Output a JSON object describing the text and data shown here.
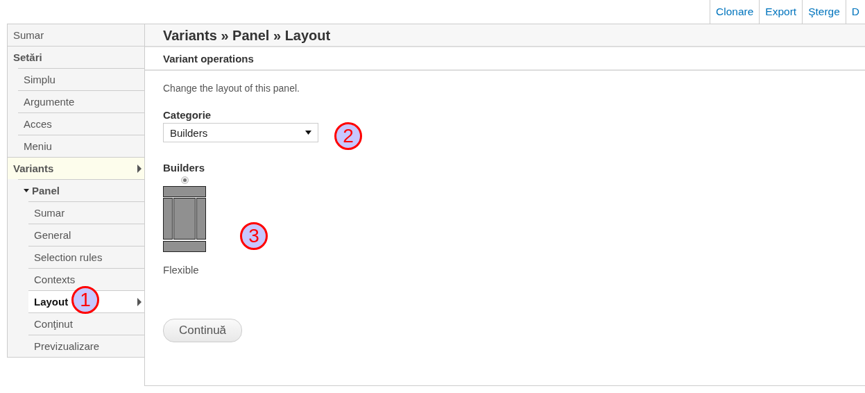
{
  "actions": [
    "Clonare",
    "Export",
    "Şterge",
    "D"
  ],
  "sidebar": {
    "items": [
      {
        "label": "Sumar",
        "kind": "link",
        "selected": false,
        "in_trail": false
      },
      {
        "label": "Setări",
        "kind": "heading",
        "selected": false,
        "in_trail": false,
        "children": [
          {
            "label": "Simplu",
            "kind": "link",
            "selected": false,
            "in_trail": false
          },
          {
            "label": "Argumente",
            "kind": "link",
            "selected": false,
            "in_trail": false
          },
          {
            "label": "Acces",
            "kind": "link",
            "selected": false,
            "in_trail": false
          },
          {
            "label": "Meniu",
            "kind": "link",
            "selected": false,
            "in_trail": false
          }
        ]
      },
      {
        "label": "Variants",
        "kind": "heading",
        "selected": false,
        "in_trail": true,
        "children": [
          {
            "label": "Panel",
            "kind": "heading",
            "selected": false,
            "in_trail": false,
            "expanded": true,
            "children": [
              {
                "label": "Sumar",
                "kind": "link",
                "selected": false,
                "in_trail": false
              },
              {
                "label": "General",
                "kind": "link",
                "selected": false,
                "in_trail": false
              },
              {
                "label": "Selection rules",
                "kind": "link",
                "selected": false,
                "in_trail": false
              },
              {
                "label": "Contexts",
                "kind": "link",
                "selected": false,
                "in_trail": false
              },
              {
                "label": "Layout",
                "kind": "link",
                "selected": true,
                "in_trail": false
              },
              {
                "label": "Conţinut",
                "kind": "link",
                "selected": false,
                "in_trail": false
              },
              {
                "label": "Previzualizare",
                "kind": "link",
                "selected": false,
                "in_trail": false
              }
            ]
          }
        ]
      }
    ]
  },
  "title": "Variants » Panel » Layout",
  "section": "Variant operations",
  "description": "Change the layout of this panel.",
  "category": {
    "label": "Categorie",
    "value": "Builders"
  },
  "group": {
    "title": "Builders",
    "layouts": [
      {
        "label": "Flexible",
        "selected": true
      }
    ]
  },
  "submit": "Continuă",
  "annotations": [
    "1",
    "2",
    "3"
  ]
}
